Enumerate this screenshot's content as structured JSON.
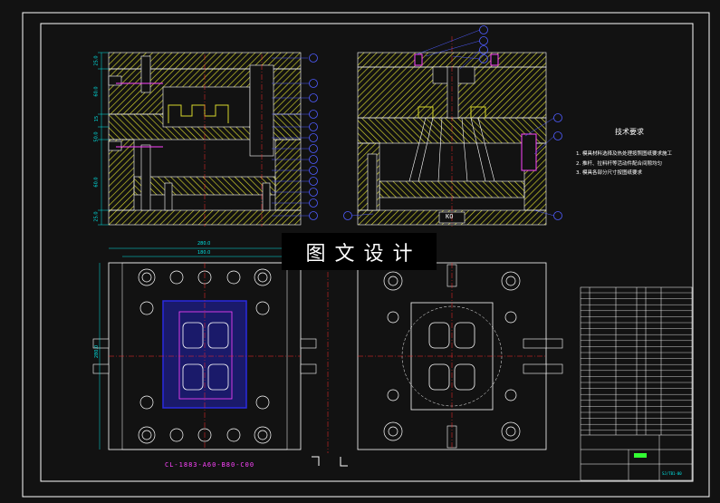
{
  "watermark": "图文设计",
  "technical_notes": {
    "title": "技术要求",
    "lines": [
      "1. 模具材料选择及热处理按照图纸要求施工",
      "2. 推杆、拉料杆等活动件配合间隙均匀",
      "3. 模具各部分尺寸按图纸要求"
    ]
  },
  "plate_label": "KO",
  "part_label": "CL-1883-A60-B80-C00",
  "dimensions": {
    "width_outer": "280.0",
    "width_inner": "180.0",
    "height": "280.0",
    "plates": [
      "25.0",
      "60.0",
      "15",
      "50.0",
      "60.0",
      "25.0"
    ]
  },
  "title_block": {
    "drawing_no": "SJ/TB1-00"
  },
  "colors": {
    "background": "#121212",
    "outline": "#ffffff",
    "hatch": "#d6d62c",
    "dimension": "#00e5e5",
    "balloon": "#4f5cff",
    "center_line": "#ff2a2a",
    "green": "#33ff33",
    "magenta": "#ff44ff",
    "cavity": "#2a2ae0"
  }
}
